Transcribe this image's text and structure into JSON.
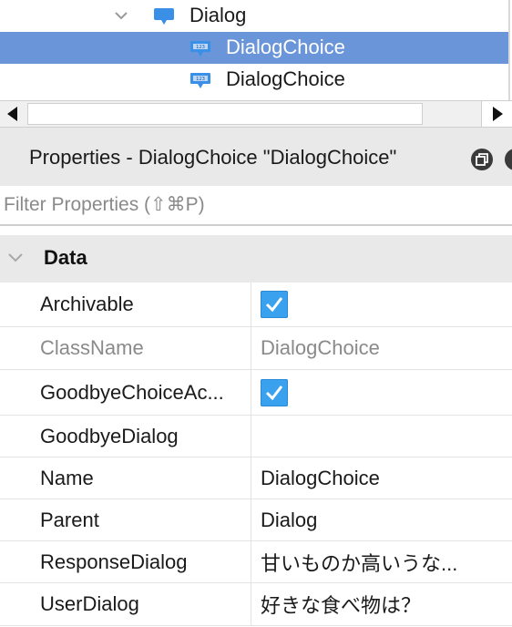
{
  "explorer": {
    "items": [
      {
        "label": "Dialog",
        "icon": "dialog-icon",
        "expanded": true,
        "selected": false
      },
      {
        "label": "DialogChoice",
        "icon": "dialog-choice-icon",
        "selected": true
      },
      {
        "label": "DialogChoice",
        "icon": "dialog-choice-icon",
        "selected": false
      }
    ],
    "selected_color": "#6a95d9"
  },
  "properties": {
    "title": "Properties - DialogChoice \"DialogChoice\"",
    "filter_placeholder": "Filter Properties (⇧⌘P)",
    "section": "Data",
    "rows": [
      {
        "name": "Archivable",
        "value": true,
        "type": "checkbox"
      },
      {
        "name": "ClassName",
        "value": "DialogChoice",
        "readonly": true
      },
      {
        "name": "GoodbyeChoiceAc...",
        "value": true,
        "type": "checkbox"
      },
      {
        "name": "GoodbyeDialog",
        "value": ""
      },
      {
        "name": "Name",
        "value": "DialogChoice"
      },
      {
        "name": "Parent",
        "value": "Dialog"
      },
      {
        "name": "ResponseDialog",
        "value": "甘いものか高いうな..."
      },
      {
        "name": "UserDialog",
        "value": "好きな食べ物は？"
      }
    ],
    "checkbox_color": "#3aa1ee"
  }
}
